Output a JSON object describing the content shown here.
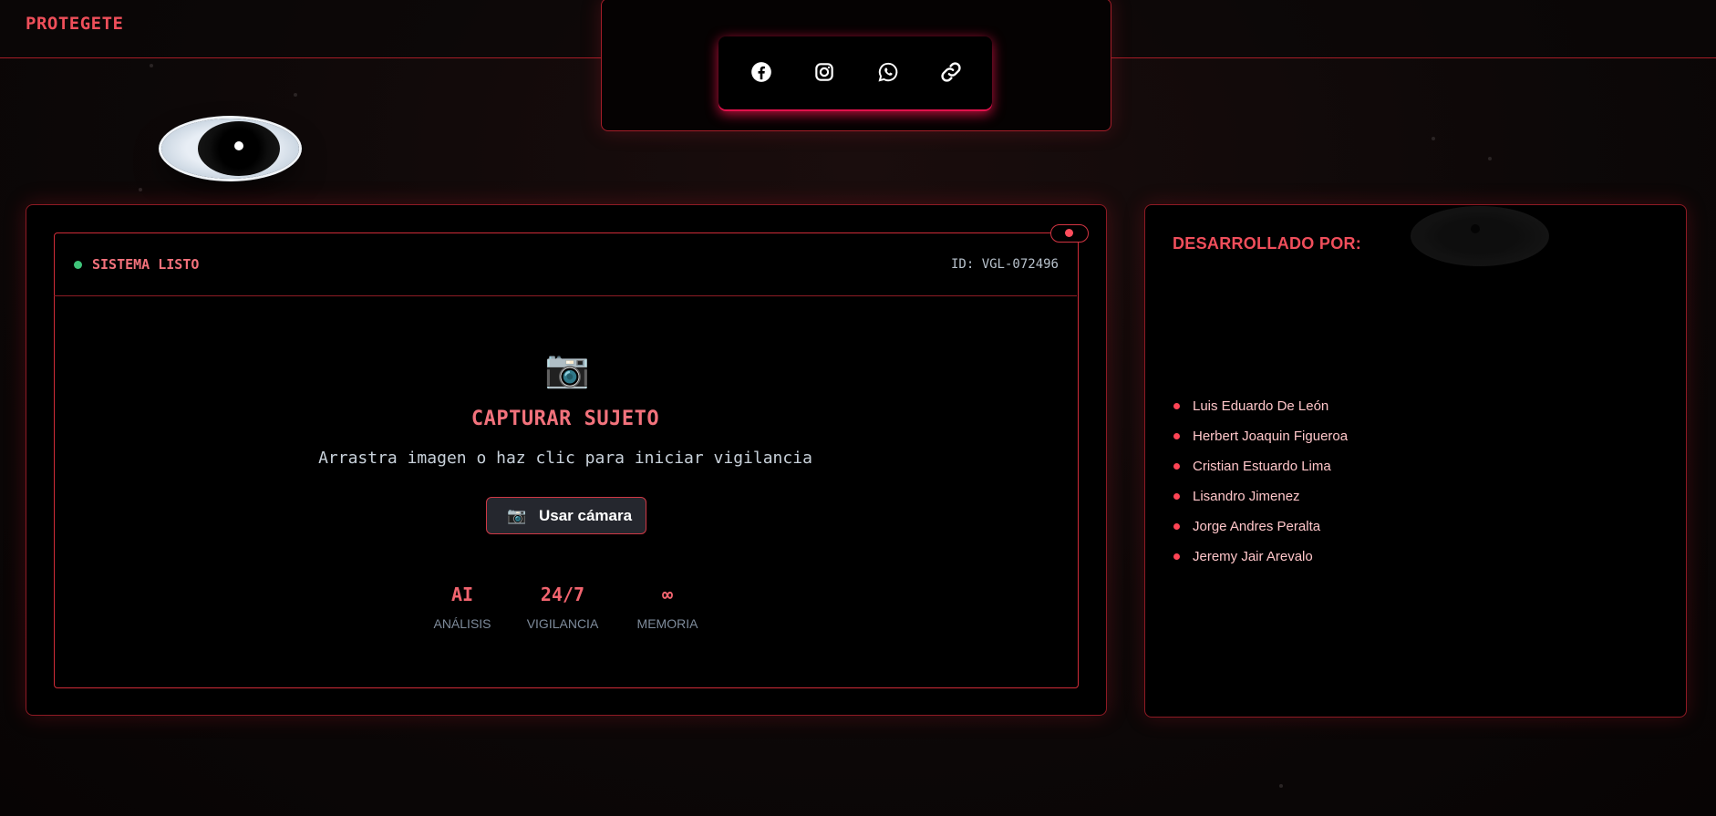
{
  "header": {
    "brand": "PROTEGETE"
  },
  "social": [
    {
      "icon": "facebook-icon",
      "glyph": "f"
    },
    {
      "icon": "instagram-icon",
      "glyph": "◎"
    },
    {
      "icon": "whatsapp-icon",
      "glyph": "✆"
    },
    {
      "icon": "link-icon",
      "glyph": "🔗"
    }
  ],
  "scanner": {
    "status": "SISTEMA LISTO",
    "id": "ID: VGL-072496",
    "camera_glyph": "📷",
    "title": "CAPTURAR SUJETO",
    "subtitle": "Arrastra imagen o haz clic para iniciar vigilancia",
    "camera_button": {
      "icon": "📷",
      "label": "Usar cámara"
    },
    "stats": [
      {
        "value": "AI",
        "label": "ANÁLISIS"
      },
      {
        "value": "24/7",
        "label": "VIGILANCIA"
      },
      {
        "value": "∞",
        "label": "MEMORIA"
      }
    ]
  },
  "credits": {
    "title": "DESARROLLADO POR:",
    "developers": [
      "Luis Eduardo De León",
      "Herbert Joaquin Figueroa",
      "Cristian Estuardo Lima",
      "Lisandro Jimenez",
      "Jorge Andres Peralta",
      "Jeremy Jair Arevalo"
    ]
  },
  "colors": {
    "accent": "#f04e5b",
    "border": "#a51d27",
    "status_ok": "#3fc47a",
    "bg": "#0b0707"
  }
}
